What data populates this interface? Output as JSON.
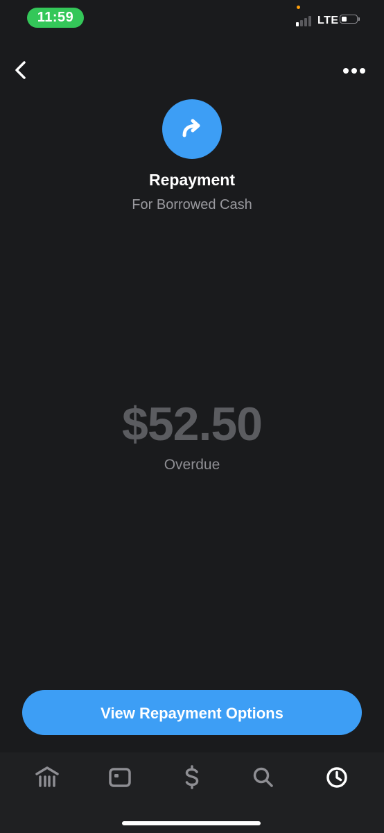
{
  "status_bar": {
    "time": "11:59",
    "network": "LTE",
    "colors": {
      "time_pill": "#34c759",
      "privacy_dot": "#ff9f0a"
    }
  },
  "header": {
    "back_icon": "chevron-left-icon",
    "more_icon": "ellipsis-horizontal-icon"
  },
  "transaction": {
    "icon": "arrow-curved-right-icon",
    "icon_background": "#3d9ef5",
    "title": "Repayment",
    "subtitle": "For Borrowed Cash",
    "amount": "$52.50",
    "status": "Overdue"
  },
  "actions": {
    "primary_label": "View Repayment Options",
    "primary_color": "#3d9ef5"
  },
  "tab_bar": {
    "items": [
      {
        "icon": "bank-icon",
        "active": false
      },
      {
        "icon": "card-icon",
        "active": false
      },
      {
        "icon": "dollar-icon",
        "active": false
      },
      {
        "icon": "search-icon",
        "active": false
      },
      {
        "icon": "clock-icon",
        "active": true
      }
    ]
  }
}
